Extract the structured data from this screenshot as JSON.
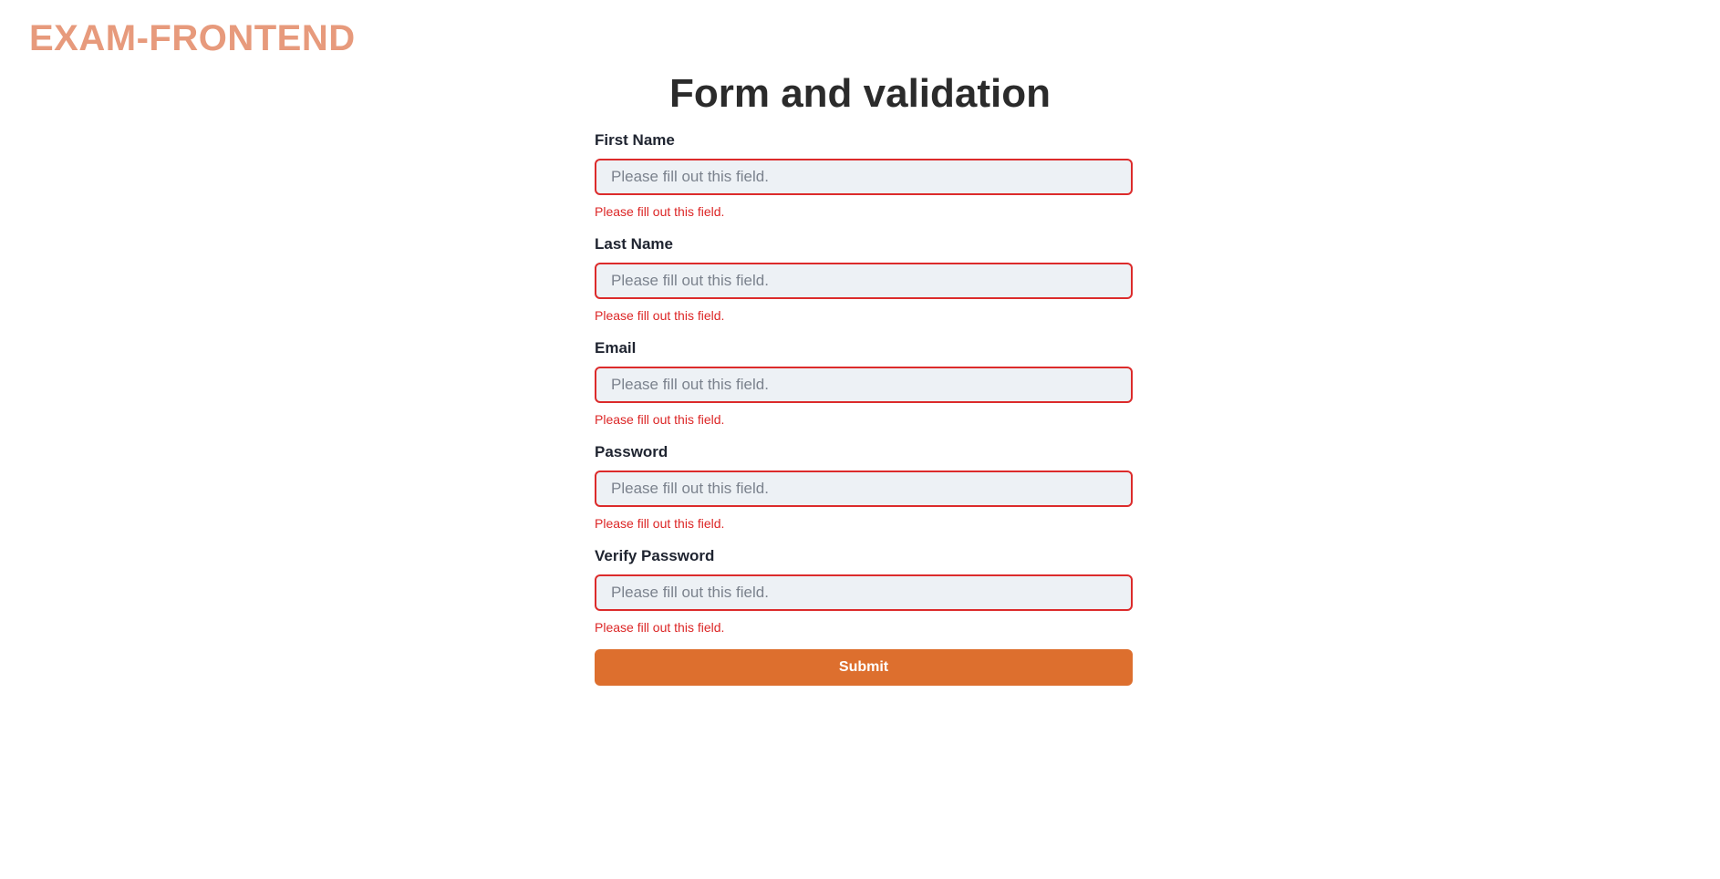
{
  "header": {
    "logo": "EXAM-FRONTEND"
  },
  "page": {
    "title": "Form and validation"
  },
  "form": {
    "fields": [
      {
        "label": "First Name",
        "value": "",
        "placeholder": "Please fill out this field.",
        "error": "Please fill out this field."
      },
      {
        "label": "Last Name",
        "value": "",
        "placeholder": "Please fill out this field.",
        "error": "Please fill out this field."
      },
      {
        "label": "Email",
        "value": "",
        "placeholder": "Please fill out this field.",
        "error": "Please fill out this field."
      },
      {
        "label": "Password",
        "value": "",
        "placeholder": "Please fill out this field.",
        "error": "Please fill out this field."
      },
      {
        "label": "Verify Password",
        "value": "",
        "placeholder": "Please fill out this field.",
        "error": "Please fill out this field."
      }
    ],
    "submit_label": "Submit"
  },
  "colors": {
    "logo": "#e79a7c",
    "error": "#dc2626",
    "input_border_error": "#dc2b2b",
    "input_background": "#edf1f5",
    "submit_background": "#dd6f2e"
  }
}
